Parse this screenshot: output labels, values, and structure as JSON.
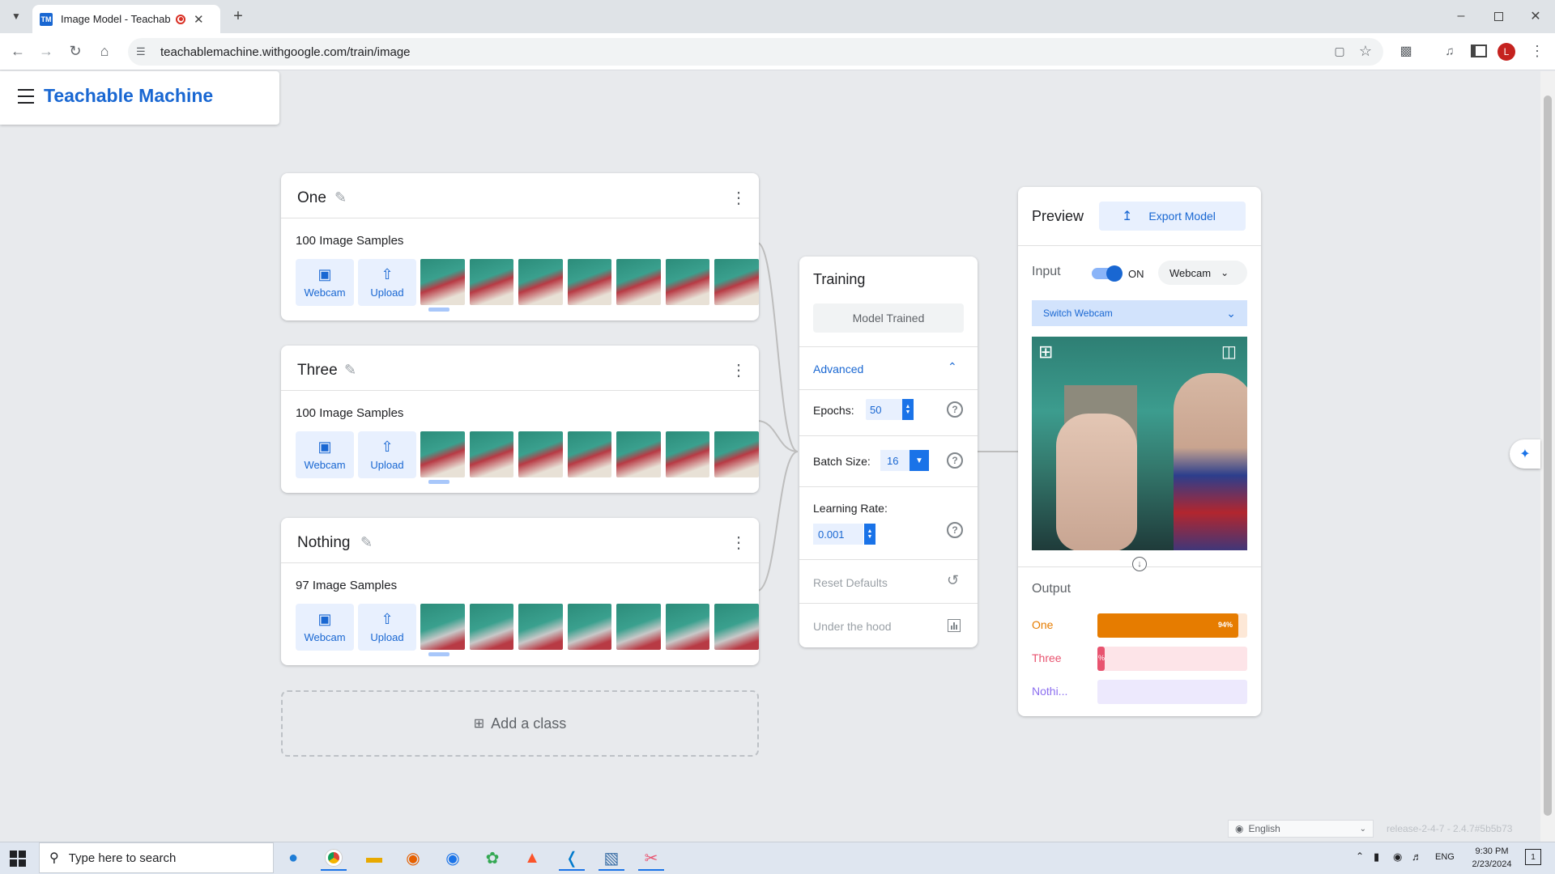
{
  "browser": {
    "tab_title": "Image Model - Teachable M",
    "tab_favicon": "TM",
    "url": "teachablemachine.withgoogle.com/train/image",
    "profile_initial": "L"
  },
  "header": {
    "title": "Teachable Machine"
  },
  "classes": [
    {
      "name": "One",
      "samples": "100 Image Samples",
      "webcam": "Webcam",
      "upload": "Upload"
    },
    {
      "name": "Three",
      "samples": "100 Image Samples",
      "webcam": "Webcam",
      "upload": "Upload"
    },
    {
      "name": "Nothing",
      "samples": "97 Image Samples",
      "webcam": "Webcam",
      "upload": "Upload"
    }
  ],
  "add_class": "Add a class",
  "training": {
    "title": "Training",
    "status_button": "Model Trained",
    "advanced": "Advanced",
    "epochs_label": "Epochs:",
    "epochs_value": "50",
    "batch_label": "Batch Size:",
    "batch_value": "16",
    "lr_label": "Learning Rate:",
    "lr_value": "0.001",
    "reset": "Reset Defaults",
    "under_hood": "Under the hood"
  },
  "preview": {
    "title": "Preview",
    "export": "Export Model",
    "input_label": "Input",
    "toggle_state": "ON",
    "source": "Webcam",
    "switch_webcam": "Switch Webcam",
    "output_label": "Output",
    "outputs": [
      {
        "label": "One",
        "percent": 94,
        "percent_text": "94%",
        "color": "#e67c00",
        "track": "#fde8d7"
      },
      {
        "label": "Three",
        "percent": 5,
        "percent_text": "%",
        "color": "#e8536f",
        "track": "#fde4e8"
      },
      {
        "label": "Nothi...",
        "percent": 0,
        "percent_text": "",
        "color": "#8c6ff0",
        "track": "#ede9fd"
      }
    ]
  },
  "footer": {
    "language": "English",
    "release": "release-2-4-7 - 2.4.7#5b5b73"
  },
  "taskbar": {
    "search_placeholder": "Type here to search",
    "lang": "ENG",
    "time": "9:30 PM",
    "date": "2/23/2024",
    "notifications": "1"
  },
  "colors": {
    "brand": "#1967d2",
    "accent_blue": "#1a73e8"
  }
}
